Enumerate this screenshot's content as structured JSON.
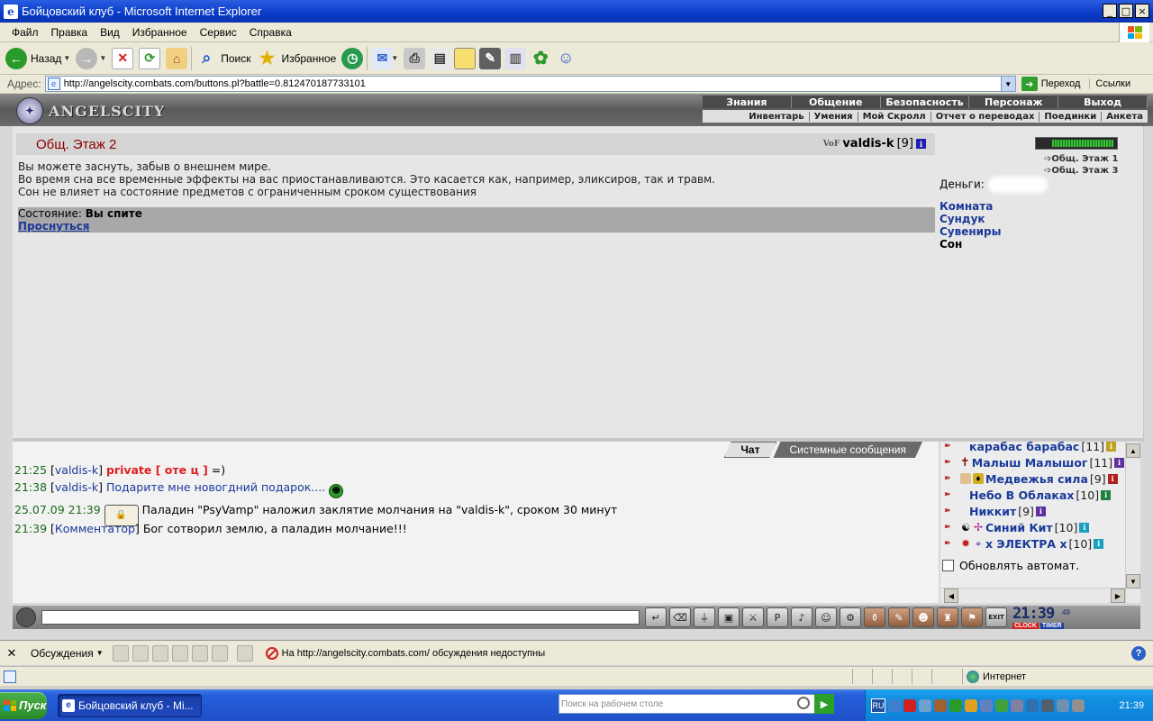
{
  "window": {
    "title": "Бойцовский клуб - Microsoft Internet Explorer",
    "buttons": {
      "minimize": "_",
      "maximize": "□",
      "close": "×"
    }
  },
  "menu": [
    "Файл",
    "Правка",
    "Вид",
    "Избранное",
    "Сервис",
    "Справка"
  ],
  "toolbar": {
    "back": "Назад",
    "search": "Поиск",
    "favorites": "Избранное"
  },
  "address": {
    "label": "Адрес:",
    "url": "http://angelscity.combats.com/buttons.pl?battle=0.812470187733101",
    "go": "Переход",
    "links": "Ссылки"
  },
  "game": {
    "logo": "ANGELSCITY",
    "nav_top": [
      "Знания",
      "Общение",
      "Безопасность",
      "Персонаж",
      "Выход"
    ],
    "nav_bottom": [
      "Инвентарь",
      "Умения",
      "Мой Скролл",
      "Отчет о переводах",
      "Поединки",
      "Анкета"
    ],
    "room_title": "Общ. Этаж 2",
    "player": {
      "clan": "VoF",
      "name": "valdis-k",
      "level": "[9]"
    },
    "sleep_lines": [
      "Вы можете заснуть, забыв о внешнем мире.",
      "Во время сна все временные эффекты на вас приостанавливаются. Это касается как, например, эликсиров, так и травм.",
      "Сон не влияет на состояние предметов с ограниченным сроком существования"
    ],
    "status_label": "Состояние:",
    "status_value": "Вы спите",
    "wake": "Проснуться",
    "floors": [
      "Общ. Этаж 1",
      "Общ. Этаж 3"
    ],
    "money_label": "Деньги:",
    "room_links": [
      "Комната",
      "Сундук",
      "Сувениры"
    ],
    "room_current": "Сон"
  },
  "chat": {
    "tabs": [
      "Чат",
      "Системные сообщения"
    ],
    "lines": [
      {
        "time": "21:25",
        "nick": "valdis-k",
        "private": "private [ оте ц ]",
        "text": "=)"
      },
      {
        "time": "21:38",
        "nick": "valdis-k",
        "text": "Подарите мне новогдний подарок...."
      },
      {
        "time": "25.07.09 21:39",
        "text": "Паладин \"PsyVamp\" наложил заклятие молчания на \"valdis-k\", сроком 30 минут"
      },
      {
        "time": "21:39",
        "nick": "Комментатор",
        "text": "Бог сотворил землю, а паладин молчание!!!"
      }
    ],
    "online": [
      {
        "name": "карабас барабас",
        "level": "[11]"
      },
      {
        "name": "Малыш Малышог",
        "level": "[11]"
      },
      {
        "name": "Медвежья сила",
        "level": "[9]"
      },
      {
        "name": "Небо В Облаках",
        "level": "[10]"
      },
      {
        "name": "Никкит",
        "level": "[9]"
      },
      {
        "name": "Синий Кит",
        "level": "[10]"
      },
      {
        "name": "х ЭЛЕКТРА х",
        "level": "[10]"
      }
    ],
    "auto_refresh": "Обновлять автомат.",
    "clock": {
      "time": "21:39",
      "seconds": "49",
      "clock_label": "CLOCK",
      "timer_label": "TIMER"
    },
    "exit_label": "EXIT"
  },
  "discussion": {
    "label": "Обсуждения",
    "message": "На http://angelscity.combats.com/ обсуждения недоступны"
  },
  "statusbar": {
    "zone": "Интернет"
  },
  "taskbar": {
    "start": "Пуск",
    "task": "Бойцовский клуб - Mi...",
    "search_placeholder": "Поиск на рабочем столе",
    "lang": "RU",
    "time": "21:39"
  },
  "colors": {
    "room_title": "#8b0000",
    "link": "#1a3a9a",
    "private": "#e02020",
    "titlebar": "#0a3bc8"
  }
}
